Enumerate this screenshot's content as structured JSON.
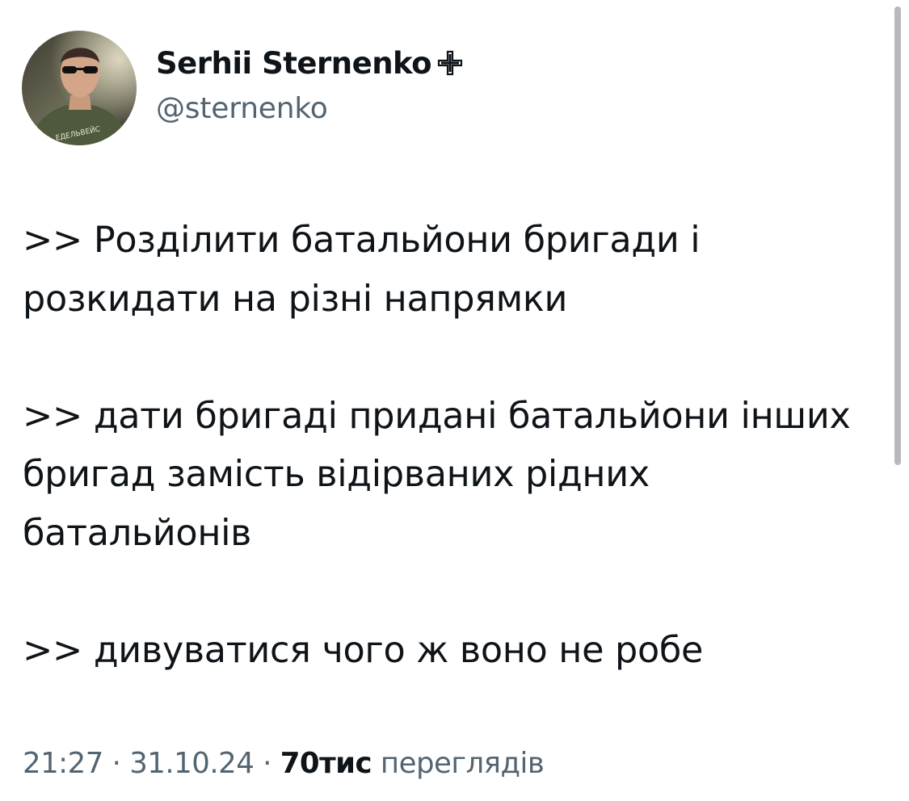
{
  "author": {
    "display_name": "Serhii Sternenko",
    "handle": "@sternenko",
    "badge_icon": "cross-icon",
    "avatar_shirt_text": "ЕДЕЛЬВЕЙС"
  },
  "tweet": {
    "paragraphs": [
      ">> Розділити батальйони бригади і розкидати на різні напрямки",
      ">> дати бригаді придані батальйони інших бригад замість відірваних рідних батальйонів",
      ">> дивуватися чого ж воно не робе"
    ],
    "time": "21:27",
    "separator": "·",
    "date": "31.10.24",
    "views_count": "70тис",
    "views_label": "переглядів"
  },
  "colors": {
    "text_primary": "#0f1419",
    "text_secondary": "#536471",
    "background": "#ffffff"
  }
}
